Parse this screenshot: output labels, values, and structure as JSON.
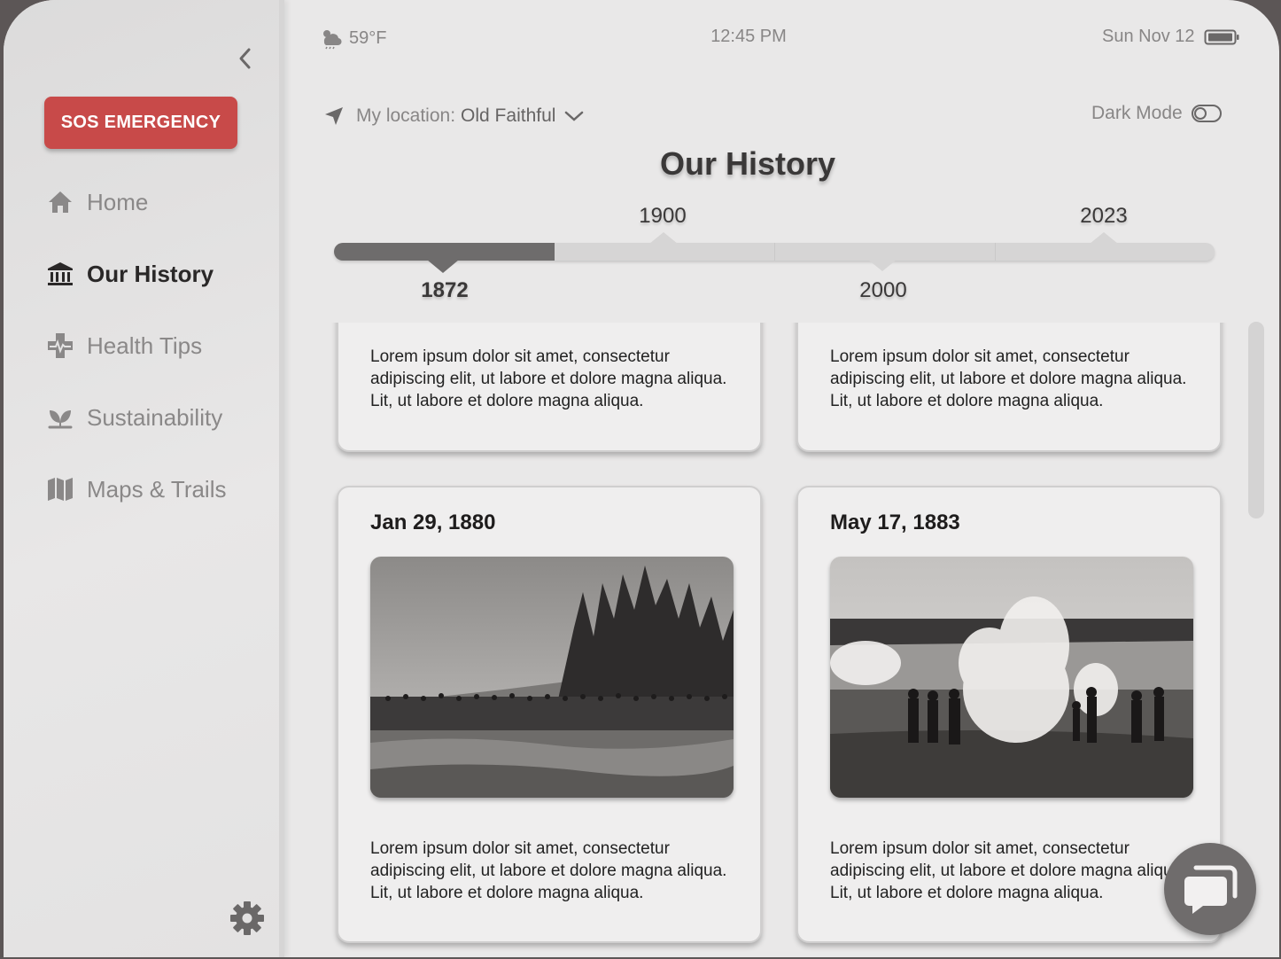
{
  "sidebar": {
    "sos_label": "SOS EMERGENCY",
    "items": [
      {
        "label": "Home",
        "icon": "home-icon",
        "active": false
      },
      {
        "label": "Our History",
        "icon": "museum-icon",
        "active": true
      },
      {
        "label": "Health Tips",
        "icon": "health-icon",
        "active": false
      },
      {
        "label": "Sustainability",
        "icon": "leaf-icon",
        "active": false
      },
      {
        "label": "Maps & Trails",
        "icon": "map-icon",
        "active": false
      }
    ]
  },
  "status_bar": {
    "weather": "59°F",
    "time": "12:45 PM",
    "date": "Sun Nov 12"
  },
  "header": {
    "location_prefix": "My location:",
    "location_value": "Old Faithful",
    "dark_mode_label": "Dark Mode",
    "dark_mode_on": false
  },
  "page": {
    "title": "Our History"
  },
  "timeline": {
    "upper_labels": [
      "1900",
      "2023"
    ],
    "lower_labels": [
      "1872",
      "2000"
    ],
    "progress": 0.25,
    "selected": "1872"
  },
  "cards": [
    {
      "date": "",
      "text": "Lorem ipsum dolor sit amet, consectetur adipiscing elit, ut labore et dolore magna aliqua. Lit, ut labore et dolore magna aliqua."
    },
    {
      "date": "",
      "text": "Lorem ipsum dolor sit amet, consectetur adipiscing elit, ut labore et dolore magna aliqua. Lit, ut labore et dolore magna aliqua."
    },
    {
      "date": "Jan 29, 1880",
      "text": "Lorem ipsum dolor sit amet, consectetur adipiscing elit, ut labore et dolore magna aliqua. Lit, ut labore et dolore magna aliqua."
    },
    {
      "date": "May 17, 1883",
      "text": "Lorem ipsum dolor sit amet, consectetur adipiscing elit, ut labore et dolore magna aliqua. Lit, ut labore et dolore magna aliqua."
    }
  ],
  "colors": {
    "sos": "#c84a49",
    "accent_dark": "#6e6c6c",
    "background": "#e9e8e8"
  }
}
